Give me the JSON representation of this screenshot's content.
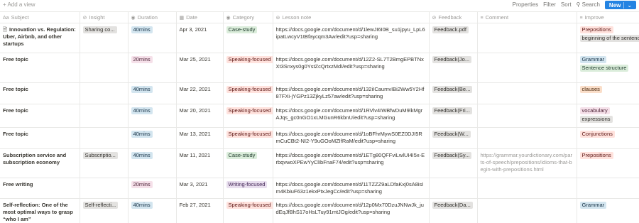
{
  "toolbar": {
    "add_view": "+ Add a view",
    "properties": "Properties",
    "filter": "Filter",
    "sort": "Sort",
    "search": "Search",
    "more": "···",
    "new": "New"
  },
  "columns": [
    {
      "icon": "Aa",
      "label": "Subject"
    },
    {
      "icon": "⊘",
      "label": "Insight"
    },
    {
      "icon": "◉",
      "label": "Duration"
    },
    {
      "icon": "▦",
      "label": "Date"
    },
    {
      "icon": "◉",
      "label": "Category"
    },
    {
      "icon": "⊜",
      "label": "Lesson note"
    },
    {
      "icon": "⊘",
      "label": "Feedback"
    },
    {
      "icon": "≡",
      "label": "Comment"
    },
    {
      "icon": "≡",
      "label": "Improve"
    }
  ],
  "rows": [
    {
      "subject": "Innovation vs. Regulation: Uber, Airbnb, and other startups",
      "has_doc_icon": true,
      "insight": "Sharing co...",
      "duration": "40mins",
      "duration_color": "blue",
      "date": "Apr 3, 2021",
      "category": "Case-study",
      "category_color": "green",
      "note": "https://docs.google.com/document/d/1lewJI6I0B_su1jpyu_LpL6ipatLwcyV1tBfaycqm3Aw/edit?usp=sharing",
      "feedback": "Feedback.pdf",
      "comment": "",
      "improve": [
        {
          "label": "Prepositions",
          "color": "red"
        },
        {
          "label": "beginning of the sentence",
          "color": "gray"
        }
      ]
    },
    {
      "subject": "Free topic",
      "has_doc_icon": false,
      "insight": "",
      "duration": "20mins",
      "duration_color": "pink",
      "date": "Mar 25, 2021",
      "category": "Speaking-focused",
      "category_color": "red",
      "note": "https://docs.google.com/document/d/12Z2-SL7T2BmgEPBTNxXt3Snxys0g0YstZcQrtxzMdI/edit?usp=sharing",
      "feedback": "Feedback(Jo...",
      "comment": "",
      "improve": [
        {
          "label": "Grammar",
          "color": "blue"
        },
        {
          "label": "Sentence structure",
          "color": "green"
        }
      ]
    },
    {
      "subject": "Free topic",
      "has_doc_icon": false,
      "insight": "",
      "duration": "40mins",
      "duration_color": "blue",
      "date": "Mar 22, 2021",
      "category": "Speaking-focused",
      "category_color": "red",
      "note": "https://docs.google.com/document/d/132iICaumvIBi2Ww5Y2Hf87FXi-jYGPz13ZjkyLz57aw/edit?usp=sharing",
      "feedback": "Feedback(Be...",
      "comment": "",
      "improve": [
        {
          "label": "clauses",
          "color": "orange"
        }
      ]
    },
    {
      "subject": "Free topic",
      "has_doc_icon": false,
      "insight": "",
      "duration": "40mins",
      "duration_color": "blue",
      "date": "Mar 20, 2021",
      "category": "Speaking-focused",
      "category_color": "red",
      "note": "https://docs.google.com/document/d/1RVlv4IWBfwDuM9lkMgrAJqs_gc0nGO1xLMGunR6kbnU/edit?usp=sharing",
      "feedback": "Feedback(Fri...",
      "comment": "",
      "improve": [
        {
          "label": "vocabulary",
          "color": "pink"
        },
        {
          "label": "expressions",
          "color": "gray"
        }
      ]
    },
    {
      "subject": "Free topic",
      "has_doc_icon": false,
      "insight": "",
      "duration": "40mins",
      "duration_color": "blue",
      "date": "Mar 13, 2021",
      "category": "Speaking-focused",
      "category_color": "red",
      "note": "https://docs.google.com/document/d/1oBFhrMywS0EZ0DJI5RmCuCBt2-NI2-Y9uGOoMZIfRaM/edit?usp=sharing",
      "feedback": "Feedback(W...",
      "comment": "",
      "improve": [
        {
          "label": "Conjunctions",
          "color": "red"
        }
      ]
    },
    {
      "subject": "Subscription service and subscription economy",
      "has_doc_icon": false,
      "insight": "Subscriptio...",
      "duration": "40mins",
      "duration_color": "blue",
      "date": "Mar 11, 2021",
      "category": "Case-study",
      "category_color": "green",
      "note": "https://docs.google.com/document/d/1ETg80QFFviLwlUI4I5x-ErbqvwoXPEwYyClIbFnaF74/edit?usp=sharing",
      "feedback": "Feedback(Sy...",
      "comment": "https://grammar.yourdictionary.com/parts-of-speech/prepositions/idioms-that-begin-with-prepositions.html",
      "improve": [
        {
          "label": "Prepositions",
          "color": "red"
        }
      ]
    },
    {
      "subject": "Free writing",
      "has_doc_icon": false,
      "insight": "",
      "duration": "20mins",
      "duration_color": "pink",
      "date": "Mar 3, 2021",
      "category": "Writing-focused",
      "category_color": "purple",
      "note": "https://docs.google.com/document/d/11TZZZ9aLDfaKxj0sA8isIm4KbiuF63z1ekxPtxJegCc/edit?usp=sharing",
      "feedback": "",
      "comment": "",
      "improve": []
    },
    {
      "subject": "Self-reflection: One of the most optimal ways to grasp “who I am”",
      "has_doc_icon": false,
      "insight": "Self-reflecti...",
      "duration": "40mins",
      "duration_color": "blue",
      "date": "Feb 27, 2021",
      "category": "Speaking-focused",
      "category_color": "red",
      "note": "https://docs.google.com/document/d/12p0Mx70DzuJNNwJk_judEqJfBhS17oHsLTuy91mtJOg/edit?usp=sharing",
      "feedback": "Feedback(Da...",
      "comment": "",
      "improve": [
        {
          "label": "Grammar",
          "color": "blue"
        }
      ]
    }
  ]
}
